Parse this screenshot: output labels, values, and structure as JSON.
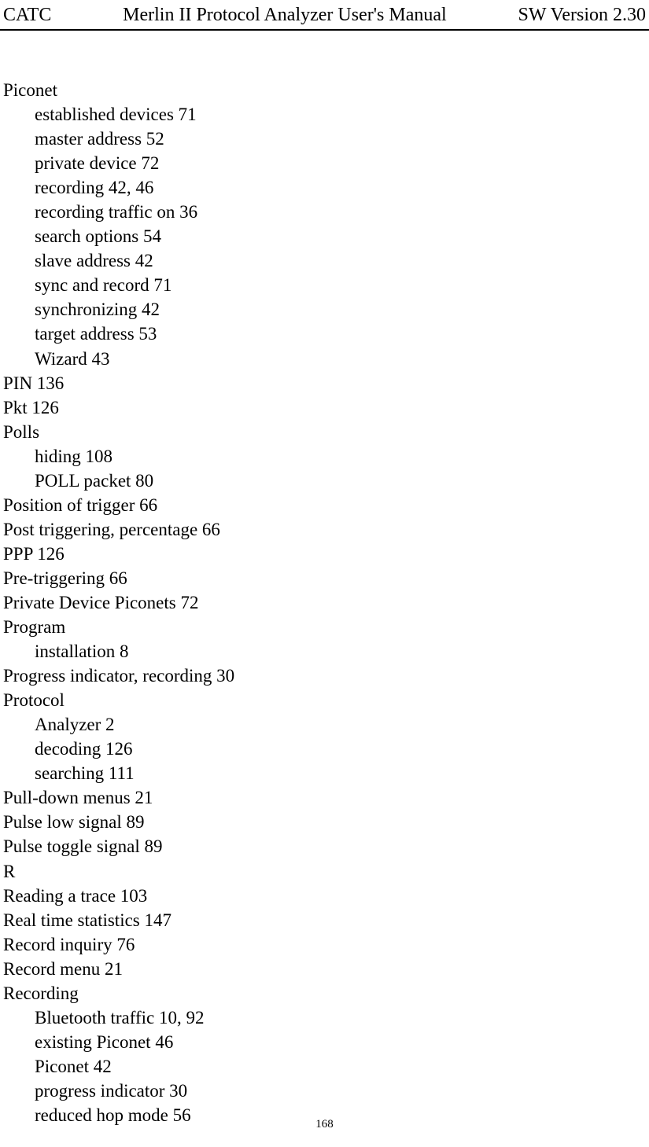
{
  "header": {
    "left": "CATC",
    "center": "Merlin II Protocol Analyzer User's Manual",
    "right": "SW Version 2.30"
  },
  "index": [
    {
      "level": 0,
      "text": "Piconet"
    },
    {
      "level": 1,
      "text": "established devices 71"
    },
    {
      "level": 1,
      "text": "master address 52"
    },
    {
      "level": 1,
      "text": "private device 72"
    },
    {
      "level": 1,
      "text": "recording 42, 46"
    },
    {
      "level": 1,
      "text": "recording traffic on 36"
    },
    {
      "level": 1,
      "text": "search options 54"
    },
    {
      "level": 1,
      "text": "slave address 42"
    },
    {
      "level": 1,
      "text": "sync and record 71"
    },
    {
      "level": 1,
      "text": "synchronizing 42"
    },
    {
      "level": 1,
      "text": "target address 53"
    },
    {
      "level": 1,
      "text": "Wizard 43"
    },
    {
      "level": 0,
      "text": "PIN 136"
    },
    {
      "level": 0,
      "text": "Pkt 126"
    },
    {
      "level": 0,
      "text": "Polls"
    },
    {
      "level": 1,
      "text": "hiding 108"
    },
    {
      "level": 1,
      "text": "POLL packet 80"
    },
    {
      "level": 0,
      "text": "Position of trigger 66"
    },
    {
      "level": 0,
      "text": "Post triggering, percentage 66"
    },
    {
      "level": 0,
      "text": "PPP 126"
    },
    {
      "level": 0,
      "text": "Pre-triggering 66"
    },
    {
      "level": 0,
      "text": "Private Device Piconets 72"
    },
    {
      "level": 0,
      "text": "Program"
    },
    {
      "level": 1,
      "text": "installation 8"
    },
    {
      "level": 0,
      "text": "Progress indicator, recording 30"
    },
    {
      "level": 0,
      "text": "Protocol"
    },
    {
      "level": 1,
      "text": "Analyzer 2"
    },
    {
      "level": 1,
      "text": "decoding 126"
    },
    {
      "level": 1,
      "text": "searching 111"
    },
    {
      "level": 0,
      "text": "Pull-down menus 21"
    },
    {
      "level": 0,
      "text": "Pulse low signal 89"
    },
    {
      "level": 0,
      "text": "Pulse toggle signal 89"
    },
    {
      "level": 0,
      "text": "R"
    },
    {
      "level": 0,
      "text": "Reading a trace 103"
    },
    {
      "level": 0,
      "text": "Real time statistics 147"
    },
    {
      "level": 0,
      "text": "Record inquiry 76"
    },
    {
      "level": 0,
      "text": "Record menu 21"
    },
    {
      "level": 0,
      "text": "Recording"
    },
    {
      "level": 1,
      "text": "Bluetooth traffic 10, 92"
    },
    {
      "level": 1,
      "text": "existing Piconet 46"
    },
    {
      "level": 1,
      "text": "Piconet 42"
    },
    {
      "level": 1,
      "text": "progress indicator 30"
    },
    {
      "level": 1,
      "text": "reduced hop mode 56"
    }
  ],
  "footer": {
    "page_number": "168"
  }
}
